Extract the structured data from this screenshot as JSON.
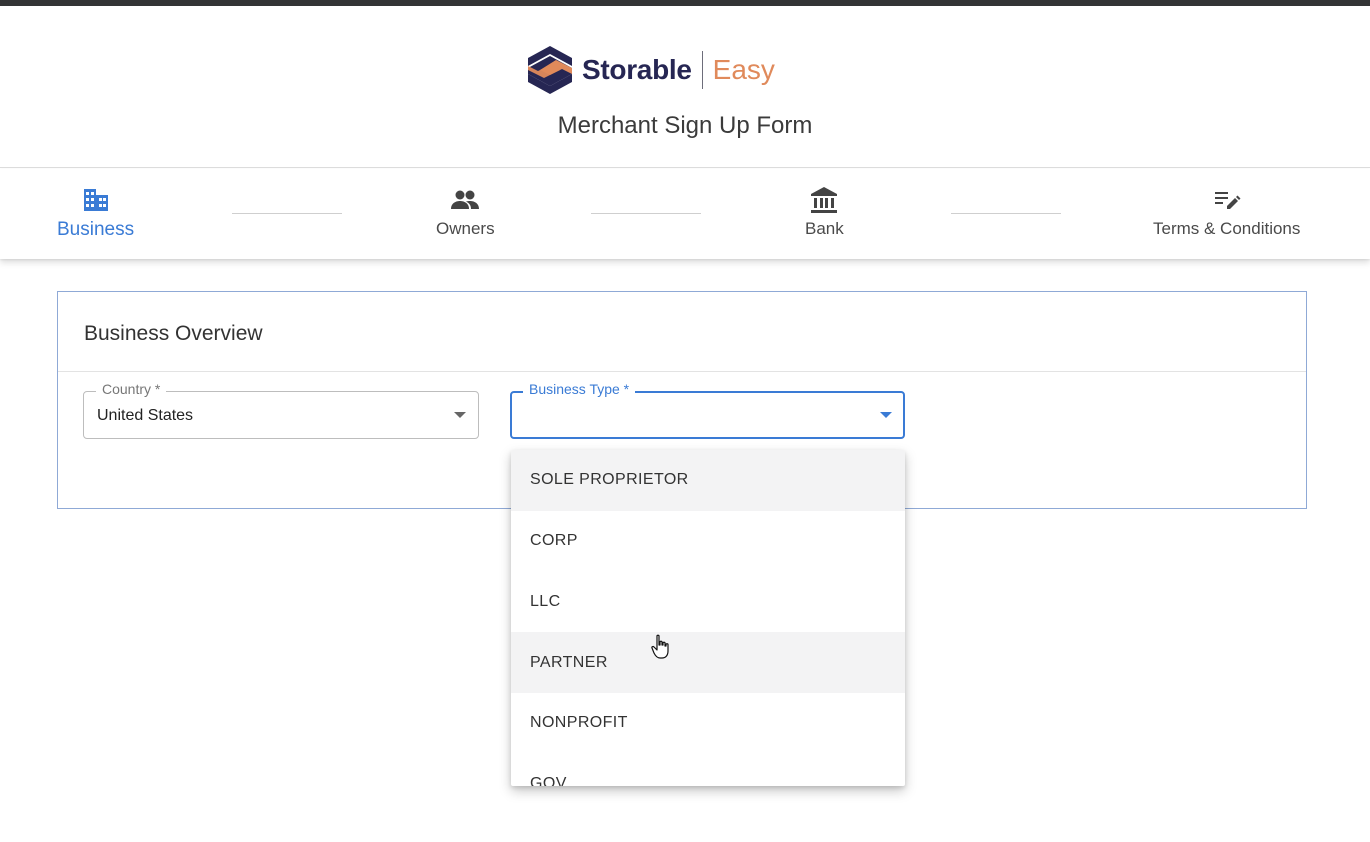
{
  "brand": {
    "name": "Storable",
    "sub": "Easy",
    "colors": {
      "navy": "#262653",
      "orange": "#e08a5b"
    }
  },
  "form_title": "Merchant Sign Up Form",
  "steps": [
    {
      "label": "Business",
      "icon": "business-icon",
      "active": true
    },
    {
      "label": "Owners",
      "icon": "people-icon",
      "active": false
    },
    {
      "label": "Bank",
      "icon": "bank-icon",
      "active": false
    },
    {
      "label": "Terms & Conditions",
      "icon": "edit-list-icon",
      "active": false
    }
  ],
  "section": {
    "title": "Business Overview"
  },
  "fields": {
    "country": {
      "label": "Country *",
      "value": "United States"
    },
    "business_type": {
      "label": "Business Type *",
      "value": ""
    }
  },
  "business_type_options": [
    "SOLE PROPRIETOR",
    "CORP",
    "LLC",
    "PARTNER",
    "NONPROFIT",
    "GOV"
  ],
  "accent_color": "#3a7bd5"
}
